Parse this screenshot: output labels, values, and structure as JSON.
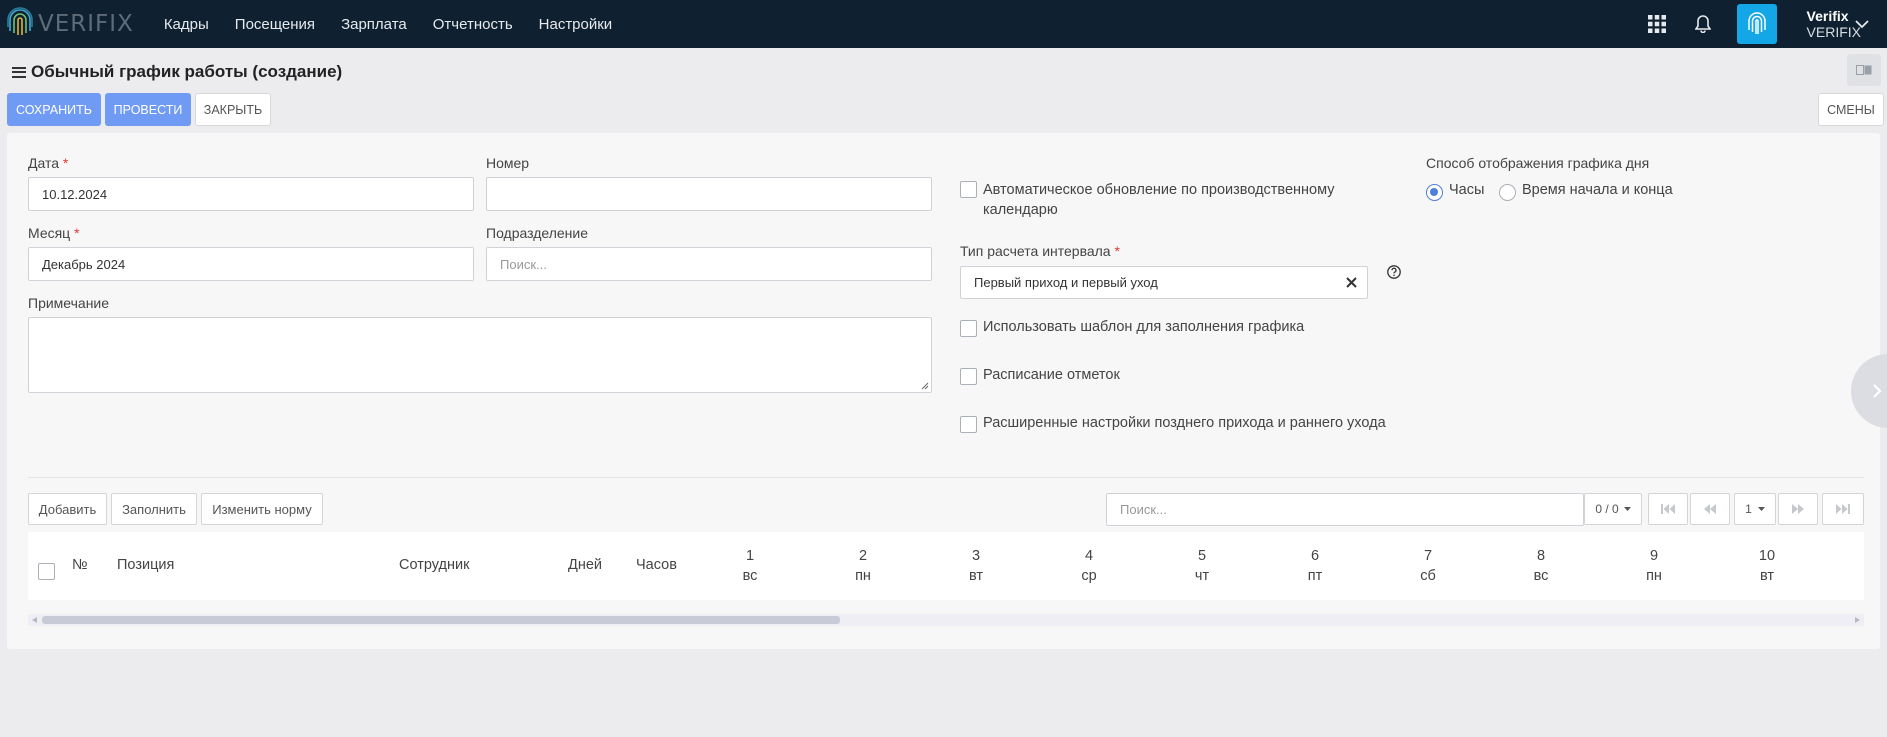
{
  "app": {
    "logo_text": "VERIFIX"
  },
  "nav": [
    "Кадры",
    "Посещения",
    "Зарплата",
    "Отчетность",
    "Настройки"
  ],
  "user": {
    "name": "Verifix",
    "company": "VERIFIX"
  },
  "page": {
    "title": "Обычный график работы (создание)"
  },
  "actions": {
    "save": "Сохранить",
    "post": "Провести",
    "close": "Закрыть",
    "shifts": "Смены"
  },
  "form": {
    "date_label": "Дата",
    "date_value": "10.12.2024",
    "number_label": "Номер",
    "number_value": "",
    "month_label": "Месяц",
    "month_value": "Декабрь 2024",
    "division_label": "Подразделение",
    "division_placeholder": "Поиск...",
    "note_label": "Примечание",
    "auto_update_label_1": "Автоматическое обновление по производственному",
    "auto_update_label_2": "календарю",
    "interval_type_label": "Тип расчета интервала",
    "interval_type_value": "Первый приход и первый уход",
    "use_template_label": "Использовать шаблон для заполнения графика",
    "schedule_marks_label": "Расписание отметок",
    "extended_settings_label": "Расширенные настройки позднего прихода и раннего ухода",
    "display_mode_label": "Способ отображения графика дня",
    "display_mode_hours": "Часы",
    "display_mode_start_end": "Время начала и конца"
  },
  "table_toolbar": {
    "add": "Добавить",
    "fill": "Заполнить",
    "change_norm": "Изменить норму",
    "search_placeholder": "Поиск...",
    "count": "0 / 0",
    "page": "1"
  },
  "table": {
    "columns": {
      "num": "№",
      "position": "Позиция",
      "employee": "Сотрудник",
      "days": "Дней",
      "hours": "Часов"
    },
    "days": [
      {
        "n": "1",
        "w": "вс"
      },
      {
        "n": "2",
        "w": "пн"
      },
      {
        "n": "3",
        "w": "вт"
      },
      {
        "n": "4",
        "w": "ср"
      },
      {
        "n": "5",
        "w": "чт"
      },
      {
        "n": "6",
        "w": "пт"
      },
      {
        "n": "7",
        "w": "сб"
      },
      {
        "n": "8",
        "w": "вс"
      },
      {
        "n": "9",
        "w": "пн"
      },
      {
        "n": "10",
        "w": "вт"
      }
    ]
  }
}
